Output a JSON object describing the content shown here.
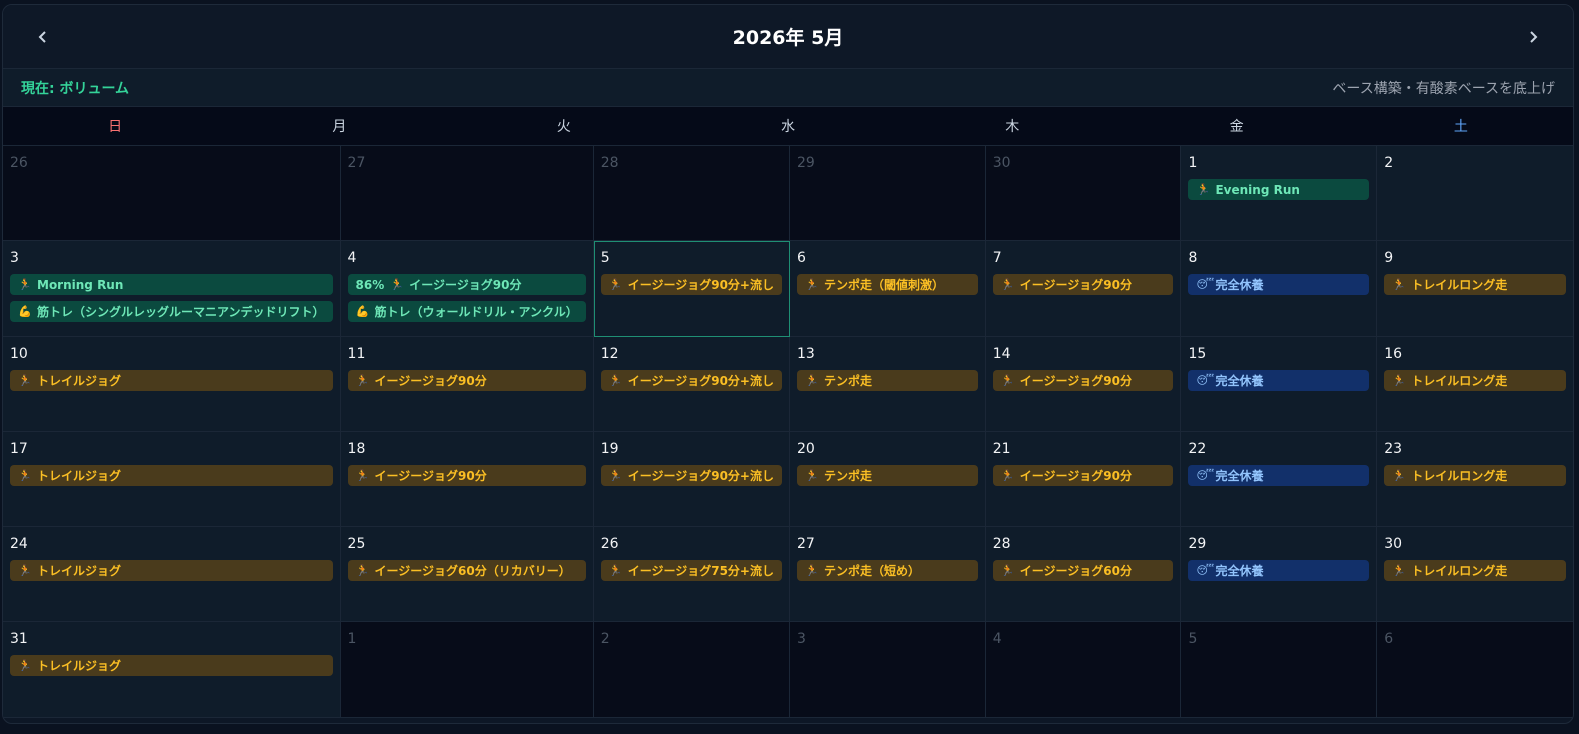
{
  "header": {
    "title": "2026年 5月",
    "prev_icon": "chevron-left-icon",
    "next_icon": "chevron-right-icon"
  },
  "phase": {
    "current": "現在: ボリューム",
    "description": "ベース構築・有酸素ベースを底上げ"
  },
  "weekdays": [
    "日",
    "月",
    "火",
    "水",
    "木",
    "金",
    "土"
  ],
  "colors": {
    "green": "#0b4a3f",
    "yellow": "#4a3b1c",
    "blue": "#12306a",
    "sunday": "#f87171",
    "saturday": "#60a5fa"
  },
  "weeks": [
    [
      {
        "day": "26",
        "other": true,
        "events": []
      },
      {
        "day": "27",
        "other": true,
        "events": []
      },
      {
        "day": "28",
        "other": true,
        "events": []
      },
      {
        "day": "29",
        "other": true,
        "events": []
      },
      {
        "day": "30",
        "other": true,
        "events": []
      },
      {
        "day": "1",
        "events": [
          {
            "type": "green",
            "icon": "🏃",
            "label": "Evening Run"
          }
        ]
      },
      {
        "day": "2",
        "events": []
      }
    ],
    [
      {
        "day": "3",
        "events": [
          {
            "type": "green",
            "icon": "🏃",
            "label": "Morning Run"
          },
          {
            "type": "green",
            "icon": "💪",
            "label": "筋トレ（シングルレッグルーマニアンデッドリフト）"
          }
        ]
      },
      {
        "day": "4",
        "events": [
          {
            "type": "green",
            "icon": "🏃",
            "label": "イージージョグ90分",
            "pct": "86%"
          },
          {
            "type": "green",
            "icon": "💪",
            "label": "筋トレ（ウォールドリル・アンクル）"
          }
        ]
      },
      {
        "day": "5",
        "today": true,
        "events": [
          {
            "type": "yellow",
            "icon": "🏃",
            "label": "イージージョグ90分+流し"
          }
        ]
      },
      {
        "day": "6",
        "events": [
          {
            "type": "yellow",
            "icon": "🏃",
            "label": "テンポ走（閾値刺激）"
          }
        ]
      },
      {
        "day": "7",
        "events": [
          {
            "type": "yellow",
            "icon": "🏃",
            "label": "イージージョグ90分"
          }
        ]
      },
      {
        "day": "8",
        "events": [
          {
            "type": "blue",
            "icon": "😴",
            "label": "完全休養"
          }
        ]
      },
      {
        "day": "9",
        "events": [
          {
            "type": "yellow",
            "icon": "🏃",
            "label": "トレイルロング走"
          }
        ]
      }
    ],
    [
      {
        "day": "10",
        "events": [
          {
            "type": "yellow",
            "icon": "🏃",
            "label": "トレイルジョグ"
          }
        ]
      },
      {
        "day": "11",
        "events": [
          {
            "type": "yellow",
            "icon": "🏃",
            "label": "イージージョグ90分"
          }
        ]
      },
      {
        "day": "12",
        "events": [
          {
            "type": "yellow",
            "icon": "🏃",
            "label": "イージージョグ90分+流し"
          }
        ]
      },
      {
        "day": "13",
        "events": [
          {
            "type": "yellow",
            "icon": "🏃",
            "label": "テンポ走"
          }
        ]
      },
      {
        "day": "14",
        "events": [
          {
            "type": "yellow",
            "icon": "🏃",
            "label": "イージージョグ90分"
          }
        ]
      },
      {
        "day": "15",
        "events": [
          {
            "type": "blue",
            "icon": "😴",
            "label": "完全休養"
          }
        ]
      },
      {
        "day": "16",
        "events": [
          {
            "type": "yellow",
            "icon": "🏃",
            "label": "トレイルロング走"
          }
        ]
      }
    ],
    [
      {
        "day": "17",
        "events": [
          {
            "type": "yellow",
            "icon": "🏃",
            "label": "トレイルジョグ"
          }
        ]
      },
      {
        "day": "18",
        "events": [
          {
            "type": "yellow",
            "icon": "🏃",
            "label": "イージージョグ90分"
          }
        ]
      },
      {
        "day": "19",
        "events": [
          {
            "type": "yellow",
            "icon": "🏃",
            "label": "イージージョグ90分+流し"
          }
        ]
      },
      {
        "day": "20",
        "events": [
          {
            "type": "yellow",
            "icon": "🏃",
            "label": "テンポ走"
          }
        ]
      },
      {
        "day": "21",
        "events": [
          {
            "type": "yellow",
            "icon": "🏃",
            "label": "イージージョグ90分"
          }
        ]
      },
      {
        "day": "22",
        "events": [
          {
            "type": "blue",
            "icon": "😴",
            "label": "完全休養"
          }
        ]
      },
      {
        "day": "23",
        "events": [
          {
            "type": "yellow",
            "icon": "🏃",
            "label": "トレイルロング走"
          }
        ]
      }
    ],
    [
      {
        "day": "24",
        "events": [
          {
            "type": "yellow",
            "icon": "🏃",
            "label": "トレイルジョグ"
          }
        ]
      },
      {
        "day": "25",
        "events": [
          {
            "type": "yellow",
            "icon": "🏃",
            "label": "イージージョグ60分（リカバリー）"
          }
        ]
      },
      {
        "day": "26",
        "events": [
          {
            "type": "yellow",
            "icon": "🏃",
            "label": "イージージョグ75分+流し"
          }
        ]
      },
      {
        "day": "27",
        "events": [
          {
            "type": "yellow",
            "icon": "🏃",
            "label": "テンポ走（短め）"
          }
        ]
      },
      {
        "day": "28",
        "events": [
          {
            "type": "yellow",
            "icon": "🏃",
            "label": "イージージョグ60分"
          }
        ]
      },
      {
        "day": "29",
        "events": [
          {
            "type": "blue",
            "icon": "😴",
            "label": "完全休養"
          }
        ]
      },
      {
        "day": "30",
        "events": [
          {
            "type": "yellow",
            "icon": "🏃",
            "label": "トレイルロング走"
          }
        ]
      }
    ],
    [
      {
        "day": "31",
        "events": [
          {
            "type": "yellow",
            "icon": "🏃",
            "label": "トレイルジョグ"
          }
        ]
      },
      {
        "day": "1",
        "other": true,
        "events": []
      },
      {
        "day": "2",
        "other": true,
        "events": []
      },
      {
        "day": "3",
        "other": true,
        "events": []
      },
      {
        "day": "4",
        "other": true,
        "events": []
      },
      {
        "day": "5",
        "other": true,
        "events": []
      },
      {
        "day": "6",
        "other": true,
        "events": []
      }
    ]
  ]
}
